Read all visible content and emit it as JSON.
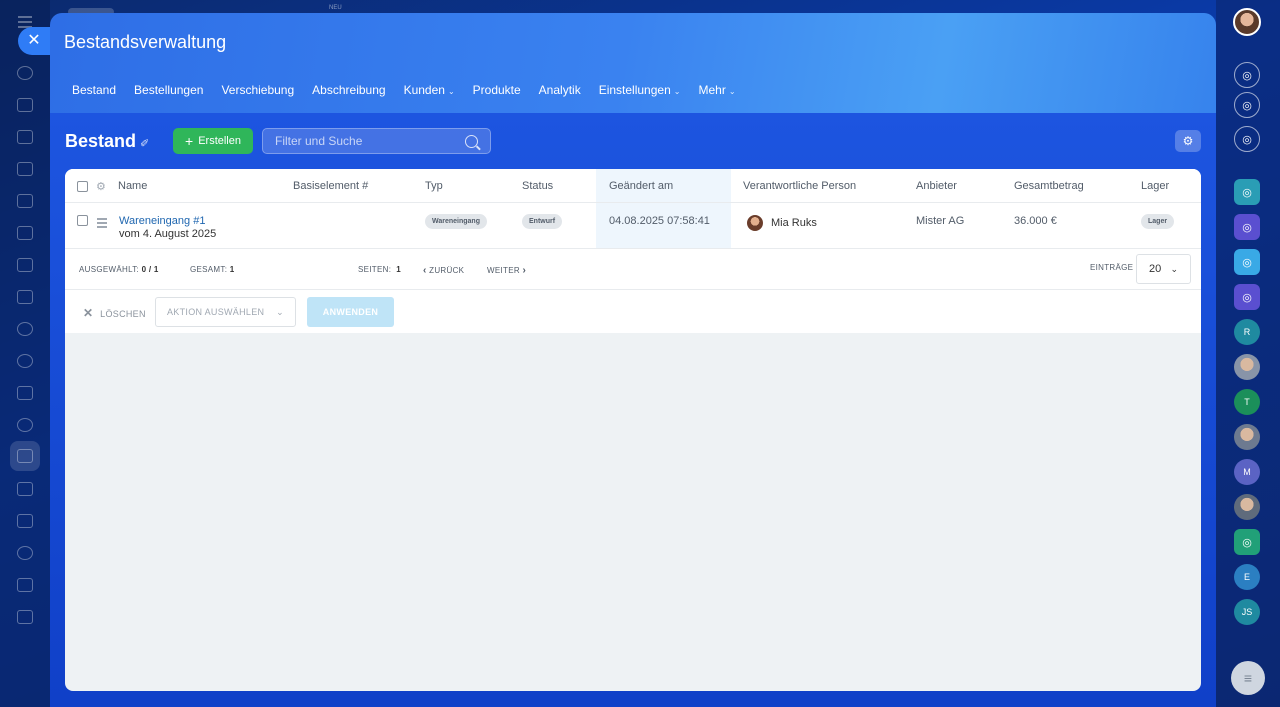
{
  "colors": {
    "accent": "#2f7cf6",
    "create_button": "#2fb65a",
    "link": "#2067b0"
  },
  "app": {
    "neu_badge": "NEU",
    "title": "Bestandsverwaltung"
  },
  "topnav": [
    {
      "label": "Bestand",
      "has_dropdown": false
    },
    {
      "label": "Bestellungen",
      "has_dropdown": false
    },
    {
      "label": "Verschiebung",
      "has_dropdown": false
    },
    {
      "label": "Abschreibung",
      "has_dropdown": false
    },
    {
      "label": "Kunden",
      "has_dropdown": true
    },
    {
      "label": "Produkte",
      "has_dropdown": false
    },
    {
      "label": "Analytik",
      "has_dropdown": false
    },
    {
      "label": "Einstellungen",
      "has_dropdown": true
    },
    {
      "label": "Mehr",
      "has_dropdown": true
    }
  ],
  "toolbar": {
    "page_title": "Bestand",
    "create_label": "Erstellen",
    "search_placeholder": "Filter und Suche",
    "search_value": ""
  },
  "grid": {
    "columns": [
      "Name",
      "Basiselement #",
      "Typ",
      "Status",
      "Geändert am",
      "Verantwortliche Person",
      "Anbieter",
      "Gesamtbetrag",
      "Lager"
    ],
    "rows": [
      {
        "name": "Wareneingang #1",
        "subtitle": "vom 4. August 2025",
        "base_element": "",
        "type": "Wareneingang",
        "status": "Entwurf",
        "modified": "04.08.2025 07:58:41",
        "person": "Mia Ruks",
        "vendor": "Mister AG",
        "total": "36.000 €",
        "storage": "Lager"
      }
    ]
  },
  "footer": {
    "selected_label": "AUSGEWÄHLT:",
    "selected_value": "0 / 1",
    "total_label": "GESAMT:",
    "total_value": "1",
    "pages_label": "SEITEN:",
    "pages_value": "1",
    "prev_label": "ZURÜCK",
    "next_label": "WEITER",
    "entries_label": "EINTRÄGE",
    "entries_value": "20"
  },
  "actions": {
    "delete_label": "LÖSCHEN",
    "select_placeholder": "AKTION AUSWÄHLEN",
    "apply_label": "ANWENDEN"
  },
  "right_rail": [
    {
      "kind": "icon",
      "icon": "bell-icon",
      "label": ""
    },
    {
      "kind": "icon",
      "icon": "at-sign-icon",
      "label": ""
    },
    {
      "kind": "icon",
      "icon": "chat-search-icon",
      "label": ""
    },
    {
      "kind": "icon",
      "icon": "document-search-icon",
      "label": "",
      "color": "#2a9db5"
    },
    {
      "kind": "icon",
      "icon": "at-sign-icon",
      "label": "",
      "color": "#5a4fd0"
    },
    {
      "kind": "icon",
      "icon": "message-icon",
      "label": "",
      "color": "#39a9e6"
    },
    {
      "kind": "icon",
      "icon": "at-sign-icon",
      "label": "",
      "color": "#5a4fd0"
    },
    {
      "kind": "letter",
      "label": "R",
      "color": "#1f8aa0"
    },
    {
      "kind": "photo",
      "label": "",
      "color": "#8894a8"
    },
    {
      "kind": "letter",
      "label": "T",
      "color": "#1b8f5a"
    },
    {
      "kind": "photo",
      "label": "",
      "color": "#6d7a90"
    },
    {
      "kind": "letter",
      "label": "M",
      "color": "#5b63c4"
    },
    {
      "kind": "photo",
      "label": "",
      "color": "#5f6b7c"
    },
    {
      "kind": "icon",
      "icon": "sheet-icon",
      "label": "",
      "color": "#21a078"
    },
    {
      "kind": "letter",
      "label": "E",
      "color": "#2b7fc2"
    },
    {
      "kind": "letter",
      "label": "JS",
      "color": "#1f8aa0"
    }
  ]
}
